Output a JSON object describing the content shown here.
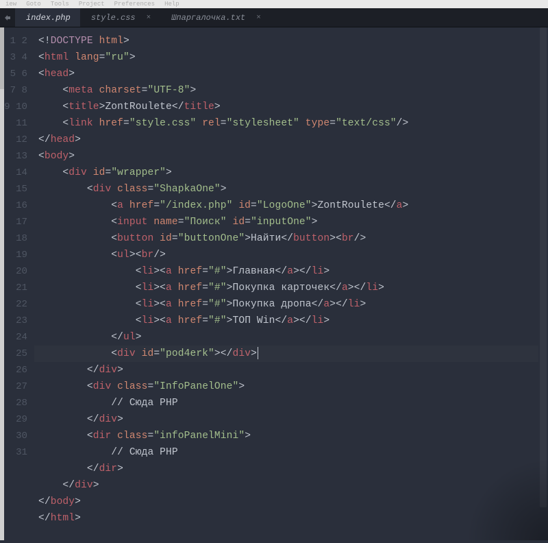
{
  "menu": {
    "items": [
      "iew",
      "Goto",
      "Tools",
      "Project",
      "Preferences",
      "Help"
    ]
  },
  "tabs": [
    {
      "label": "index.php",
      "active": true,
      "closable": false
    },
    {
      "label": "style.css",
      "active": false,
      "closable": true
    },
    {
      "label": "Шпаргалочка.txt",
      "active": false,
      "closable": true
    }
  ],
  "gutter": {
    "start": 1,
    "end": 31
  },
  "code": {
    "lines": [
      [
        [
          "p",
          "<!"
        ],
        [
          "kw",
          "DOCTYPE"
        ],
        [
          "p",
          " "
        ],
        [
          "at",
          "html"
        ],
        [
          "p",
          ">"
        ]
      ],
      [
        [
          "p",
          "<"
        ],
        [
          "tg",
          "html"
        ],
        [
          "p",
          " "
        ],
        [
          "at",
          "lang"
        ],
        [
          "op",
          "="
        ],
        [
          "st",
          "\"ru\""
        ],
        [
          "p",
          ">"
        ]
      ],
      [
        [
          "p",
          "<"
        ],
        [
          "tg",
          "head"
        ],
        [
          "p",
          ">"
        ]
      ],
      [
        [
          "p",
          "    <"
        ],
        [
          "tg",
          "meta"
        ],
        [
          "p",
          " "
        ],
        [
          "at",
          "charset"
        ],
        [
          "op",
          "="
        ],
        [
          "st",
          "\"UTF-8\""
        ],
        [
          "p",
          ">"
        ]
      ],
      [
        [
          "p",
          "    <"
        ],
        [
          "tg",
          "title"
        ],
        [
          "p",
          ">"
        ],
        [
          "tx",
          "ZontRoulete"
        ],
        [
          "p",
          "</"
        ],
        [
          "tg",
          "title"
        ],
        [
          "p",
          ">"
        ]
      ],
      [
        [
          "p",
          "    <"
        ],
        [
          "tg",
          "link"
        ],
        [
          "p",
          " "
        ],
        [
          "at",
          "href"
        ],
        [
          "op",
          "="
        ],
        [
          "st",
          "\"style.css\""
        ],
        [
          "p",
          " "
        ],
        [
          "at",
          "rel"
        ],
        [
          "op",
          "="
        ],
        [
          "st",
          "\"stylesheet\""
        ],
        [
          "p",
          " "
        ],
        [
          "at",
          "type"
        ],
        [
          "op",
          "="
        ],
        [
          "st",
          "\"text/css\""
        ],
        [
          "p",
          "/>"
        ]
      ],
      [
        [
          "p",
          "</"
        ],
        [
          "tg",
          "head"
        ],
        [
          "p",
          ">"
        ]
      ],
      [
        [
          "p",
          "<"
        ],
        [
          "tg",
          "body"
        ],
        [
          "p",
          ">"
        ]
      ],
      [
        [
          "p",
          "    <"
        ],
        [
          "tg",
          "div"
        ],
        [
          "p",
          " "
        ],
        [
          "at",
          "id"
        ],
        [
          "op",
          "="
        ],
        [
          "st",
          "\"wrapper\""
        ],
        [
          "p",
          ">"
        ]
      ],
      [
        [
          "p",
          "        <"
        ],
        [
          "tg",
          "div"
        ],
        [
          "p",
          " "
        ],
        [
          "at",
          "class"
        ],
        [
          "op",
          "="
        ],
        [
          "st",
          "\"ShapkaOne\""
        ],
        [
          "p",
          ">"
        ]
      ],
      [
        [
          "p",
          "            <"
        ],
        [
          "tg",
          "a"
        ],
        [
          "p",
          " "
        ],
        [
          "at",
          "href"
        ],
        [
          "op",
          "="
        ],
        [
          "st",
          "\"/index.php\""
        ],
        [
          "p",
          " "
        ],
        [
          "at",
          "id"
        ],
        [
          "op",
          "="
        ],
        [
          "st",
          "\"LogoOne\""
        ],
        [
          "p",
          ">"
        ],
        [
          "tx",
          "ZontRoulete"
        ],
        [
          "p",
          "</"
        ],
        [
          "tg",
          "a"
        ],
        [
          "p",
          ">"
        ]
      ],
      [
        [
          "p",
          "            <"
        ],
        [
          "tg",
          "input"
        ],
        [
          "p",
          " "
        ],
        [
          "at",
          "name"
        ],
        [
          "op",
          "="
        ],
        [
          "st",
          "\"Поиск\""
        ],
        [
          "p",
          " "
        ],
        [
          "at",
          "id"
        ],
        [
          "op",
          "="
        ],
        [
          "st",
          "\"inputOne\""
        ],
        [
          "p",
          ">"
        ]
      ],
      [
        [
          "p",
          "            <"
        ],
        [
          "tg",
          "button"
        ],
        [
          "p",
          " "
        ],
        [
          "at",
          "id"
        ],
        [
          "op",
          "="
        ],
        [
          "st",
          "\"buttonOne\""
        ],
        [
          "p",
          ">"
        ],
        [
          "tx",
          "Найти"
        ],
        [
          "p",
          "</"
        ],
        [
          "tg",
          "button"
        ],
        [
          "p",
          "><"
        ],
        [
          "tg",
          "br"
        ],
        [
          "p",
          "/>"
        ]
      ],
      [
        [
          "p",
          "            <"
        ],
        [
          "tg",
          "ul"
        ],
        [
          "p",
          "><"
        ],
        [
          "tg",
          "br"
        ],
        [
          "p",
          "/>"
        ]
      ],
      [
        [
          "p",
          "                <"
        ],
        [
          "tg",
          "li"
        ],
        [
          "p",
          "><"
        ],
        [
          "tg",
          "a"
        ],
        [
          "p",
          " "
        ],
        [
          "at",
          "href"
        ],
        [
          "op",
          "="
        ],
        [
          "st",
          "\"#\""
        ],
        [
          "p",
          ">"
        ],
        [
          "tx",
          "Главная"
        ],
        [
          "p",
          "</"
        ],
        [
          "tg",
          "a"
        ],
        [
          "p",
          "></"
        ],
        [
          "tg",
          "li"
        ],
        [
          "p",
          ">"
        ]
      ],
      [
        [
          "p",
          "                <"
        ],
        [
          "tg",
          "li"
        ],
        [
          "p",
          "><"
        ],
        [
          "tg",
          "a"
        ],
        [
          "p",
          " "
        ],
        [
          "at",
          "href"
        ],
        [
          "op",
          "="
        ],
        [
          "st",
          "\"#\""
        ],
        [
          "p",
          ">"
        ],
        [
          "tx",
          "Покупка карточек"
        ],
        [
          "p",
          "</"
        ],
        [
          "tg",
          "a"
        ],
        [
          "p",
          "></"
        ],
        [
          "tg",
          "li"
        ],
        [
          "p",
          ">"
        ]
      ],
      [
        [
          "p",
          "                <"
        ],
        [
          "tg",
          "li"
        ],
        [
          "p",
          "><"
        ],
        [
          "tg",
          "a"
        ],
        [
          "p",
          " "
        ],
        [
          "at",
          "href"
        ],
        [
          "op",
          "="
        ],
        [
          "st",
          "\"#\""
        ],
        [
          "p",
          ">"
        ],
        [
          "tx",
          "Покупка дропа"
        ],
        [
          "p",
          "</"
        ],
        [
          "tg",
          "a"
        ],
        [
          "p",
          "></"
        ],
        [
          "tg",
          "li"
        ],
        [
          "p",
          ">"
        ]
      ],
      [
        [
          "p",
          "                <"
        ],
        [
          "tg",
          "li"
        ],
        [
          "p",
          "><"
        ],
        [
          "tg",
          "a"
        ],
        [
          "p",
          " "
        ],
        [
          "at",
          "href"
        ],
        [
          "op",
          "="
        ],
        [
          "st",
          "\"#\""
        ],
        [
          "p",
          ">"
        ],
        [
          "tx",
          "ТОП Win"
        ],
        [
          "p",
          "</"
        ],
        [
          "tg",
          "a"
        ],
        [
          "p",
          "></"
        ],
        [
          "tg",
          "li"
        ],
        [
          "p",
          ">"
        ]
      ],
      [
        [
          "p",
          "            </"
        ],
        [
          "tg",
          "ul"
        ],
        [
          "p",
          ">"
        ]
      ],
      [
        [
          "p",
          "            <"
        ],
        [
          "tg",
          "div"
        ],
        [
          "p",
          " "
        ],
        [
          "at",
          "id"
        ],
        [
          "op",
          "="
        ],
        [
          "st",
          "\"pod4erk\""
        ],
        [
          "p",
          "></"
        ],
        [
          "tg",
          "div"
        ],
        [
          "p",
          ">"
        ],
        [
          "cur",
          ""
        ]
      ],
      [
        [
          "p",
          "        </"
        ],
        [
          "tg",
          "div"
        ],
        [
          "p",
          ">"
        ]
      ],
      [
        [
          "p",
          "        <"
        ],
        [
          "tg",
          "div"
        ],
        [
          "p",
          " "
        ],
        [
          "at",
          "class"
        ],
        [
          "op",
          "="
        ],
        [
          "st",
          "\"InfoPanelOne\""
        ],
        [
          "p",
          ">"
        ]
      ],
      [
        [
          "tx",
          "            // Сюда PHP"
        ]
      ],
      [
        [
          "p",
          "        </"
        ],
        [
          "tg",
          "div"
        ],
        [
          "p",
          ">"
        ]
      ],
      [
        [
          "p",
          "        <"
        ],
        [
          "tg",
          "dir"
        ],
        [
          "p",
          " "
        ],
        [
          "at",
          "class"
        ],
        [
          "op",
          "="
        ],
        [
          "st",
          "\"infoPanelMini\""
        ],
        [
          "p",
          ">"
        ]
      ],
      [
        [
          "tx",
          "            // Сюда PHP"
        ]
      ],
      [
        [
          "p",
          "        </"
        ],
        [
          "tg",
          "dir"
        ],
        [
          "p",
          ">"
        ]
      ],
      [
        [
          "p",
          "    </"
        ],
        [
          "tg",
          "div"
        ],
        [
          "p",
          ">"
        ]
      ],
      [
        [
          "p",
          "</"
        ],
        [
          "tg",
          "body"
        ],
        [
          "p",
          ">"
        ]
      ],
      [
        [
          "p",
          "</"
        ],
        [
          "tg",
          "html"
        ],
        [
          "p",
          ">"
        ]
      ],
      [
        [
          "p",
          ""
        ]
      ]
    ],
    "active_line": 20
  }
}
